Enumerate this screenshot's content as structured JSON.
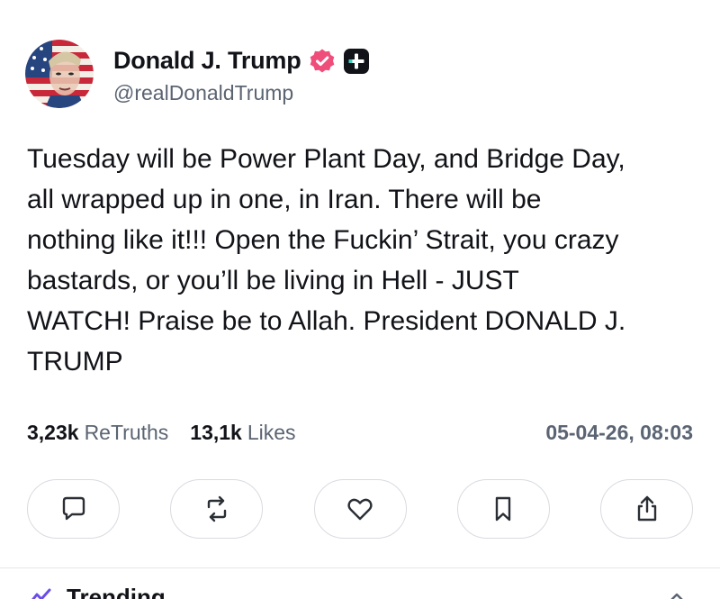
{
  "profile": {
    "display_name": "Donald J. Trump",
    "handle": "@realDonaldTrump",
    "avatar_icon": "flag-portrait-avatar",
    "verified_icon": "verified-badge-icon",
    "plus_icon": "truth-plus-badge-icon"
  },
  "post": {
    "text": "Tuesday will be Power Plant Day, and Bridge Day,\nall wrapped up in one, in Iran. There will be\nnothing like it!!! Open the Fuckin’ Strait, you crazy\nbastards, or you’ll be living in Hell - JUST\nWATCH! Praise be to Allah. President DONALD J.\nTRUMP"
  },
  "stats": {
    "retruths_count": "3,23k",
    "retruths_label": "ReTruths",
    "likes_count": "13,1k",
    "likes_label": "Likes",
    "timestamp": "05-04-26, 08:03"
  },
  "actions": [
    {
      "name": "reply",
      "icon": "comment-icon"
    },
    {
      "name": "retruth",
      "icon": "repost-icon"
    },
    {
      "name": "like",
      "icon": "heart-icon"
    },
    {
      "name": "bookmark",
      "icon": "bookmark-icon"
    },
    {
      "name": "share",
      "icon": "share-icon"
    }
  ],
  "section": {
    "trending_label": "Trending"
  },
  "colors": {
    "verified": "#f04e7a",
    "text_primary": "#111318",
    "text_secondary": "#5b6472",
    "border": "#d8dbe0",
    "accent_purple": "#6b4de6"
  }
}
